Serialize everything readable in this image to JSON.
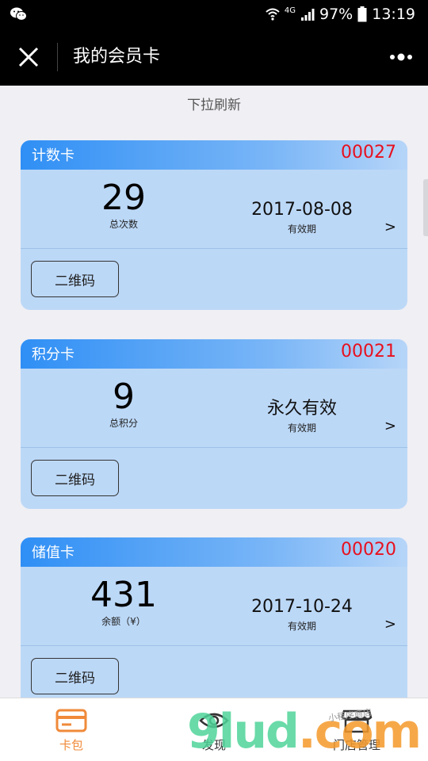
{
  "status_bar": {
    "network": "4G",
    "battery": "97%",
    "time": "13:19"
  },
  "nav": {
    "title": "我的会员卡"
  },
  "refresh_hint": "下拉刷新",
  "cards": [
    {
      "type": "计数卡",
      "number": "00027",
      "main_value": "29",
      "main_caption": "总次数",
      "expiry": "2017-08-08",
      "expiry_caption": "有效期",
      "arrow": ">",
      "qr_label": "二维码"
    },
    {
      "type": "积分卡",
      "number": "00021",
      "main_value": "9",
      "main_caption": "总积分",
      "expiry": "永久有效",
      "expiry_caption": "有效期",
      "arrow": ">",
      "qr_label": "二维码"
    },
    {
      "type": "储值卡",
      "number": "00020",
      "main_value": "431",
      "main_caption": "余额（¥）",
      "expiry": "2017-10-24",
      "expiry_caption": "有效期",
      "arrow": ">",
      "qr_label": "二维码"
    }
  ],
  "tabs": [
    {
      "label": "卡包",
      "icon": "card-wallet-icon",
      "active": true
    },
    {
      "label": "发现",
      "icon": "eye-icon",
      "active": false
    },
    {
      "label": "门店管理",
      "icon": "store-icon",
      "active": false
    }
  ],
  "watermark": {
    "main": "9lud",
    "suffix": ".com",
    "sub": "小程序商店"
  },
  "colors": {
    "accent_orange": "#f08a3a",
    "card_bg": "#bcd8f7",
    "header_blue": "#2f8ff5",
    "card_no_red": "#e8101e"
  }
}
